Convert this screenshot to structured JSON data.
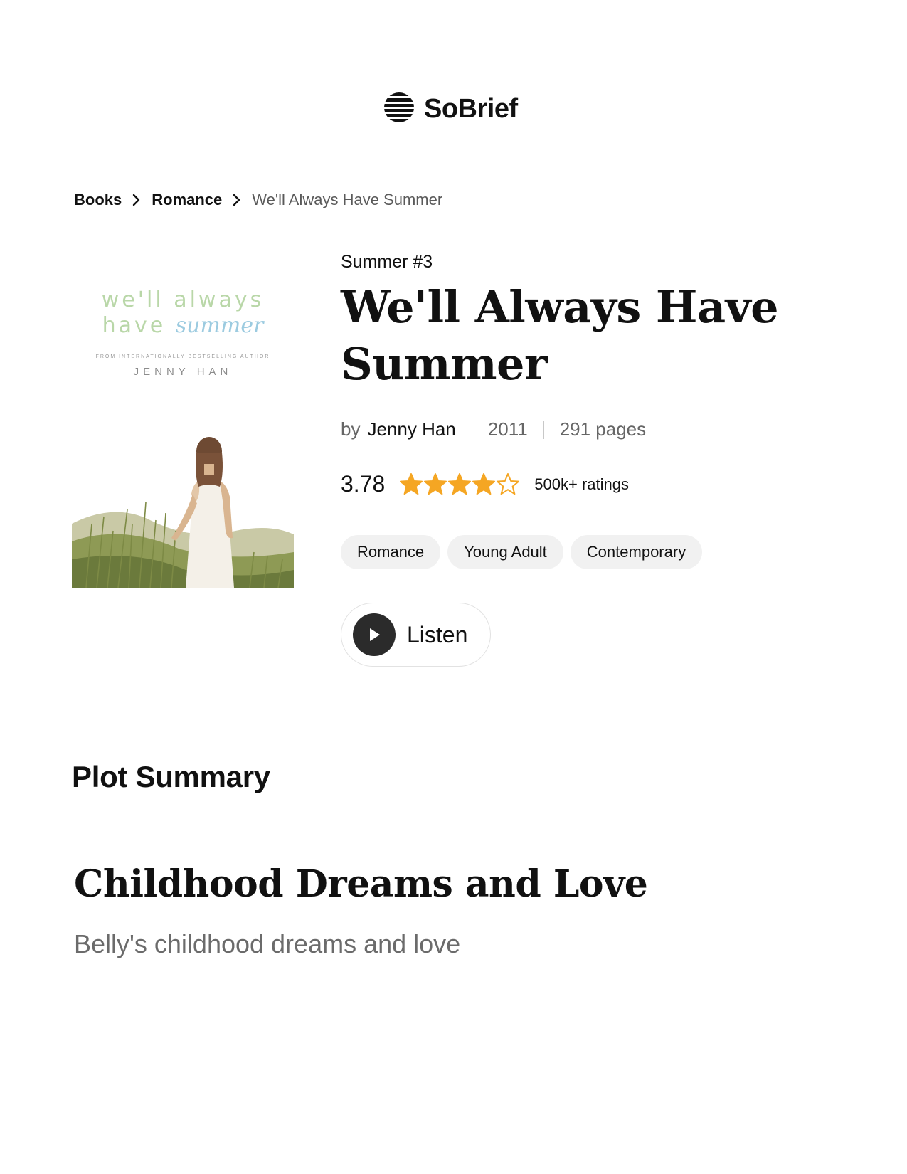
{
  "brand": {
    "name": "SoBrief"
  },
  "breadcrumb": {
    "items": [
      {
        "label": "Books"
      },
      {
        "label": "Romance"
      },
      {
        "label": "We'll Always Have Summer"
      }
    ]
  },
  "cover": {
    "title_line1": "we'll always",
    "title_line2_a": "have",
    "title_line2_b": "summer",
    "tagline": "from internationally bestselling author",
    "author": "JENNY HAN"
  },
  "book": {
    "series": "Summer #3",
    "title": "We'll Always Have Summer",
    "by_label": "by",
    "author": "Jenny Han",
    "year": "2011",
    "pages": "291 pages",
    "rating": "3.78",
    "rating_value": 3.78,
    "rating_max": 5,
    "ratings_count": "500k+ ratings",
    "tags": [
      "Romance",
      "Young Adult",
      "Contemporary"
    ],
    "listen_label": "Listen"
  },
  "colors": {
    "star": "#f5a623",
    "text": "#111111",
    "muted": "#666666",
    "tag_bg": "#f1f1f1",
    "play_bg": "#2b2b2b"
  },
  "icons": {
    "logo": "striped-circle-icon",
    "breadcrumb_separator": "chevron-right-icon",
    "star": "star-icon",
    "play": "play-icon"
  },
  "plot": {
    "heading": "Plot Summary",
    "chapter_title": "Childhood Dreams and Love",
    "chapter_text": "Belly's childhood dreams and love"
  }
}
